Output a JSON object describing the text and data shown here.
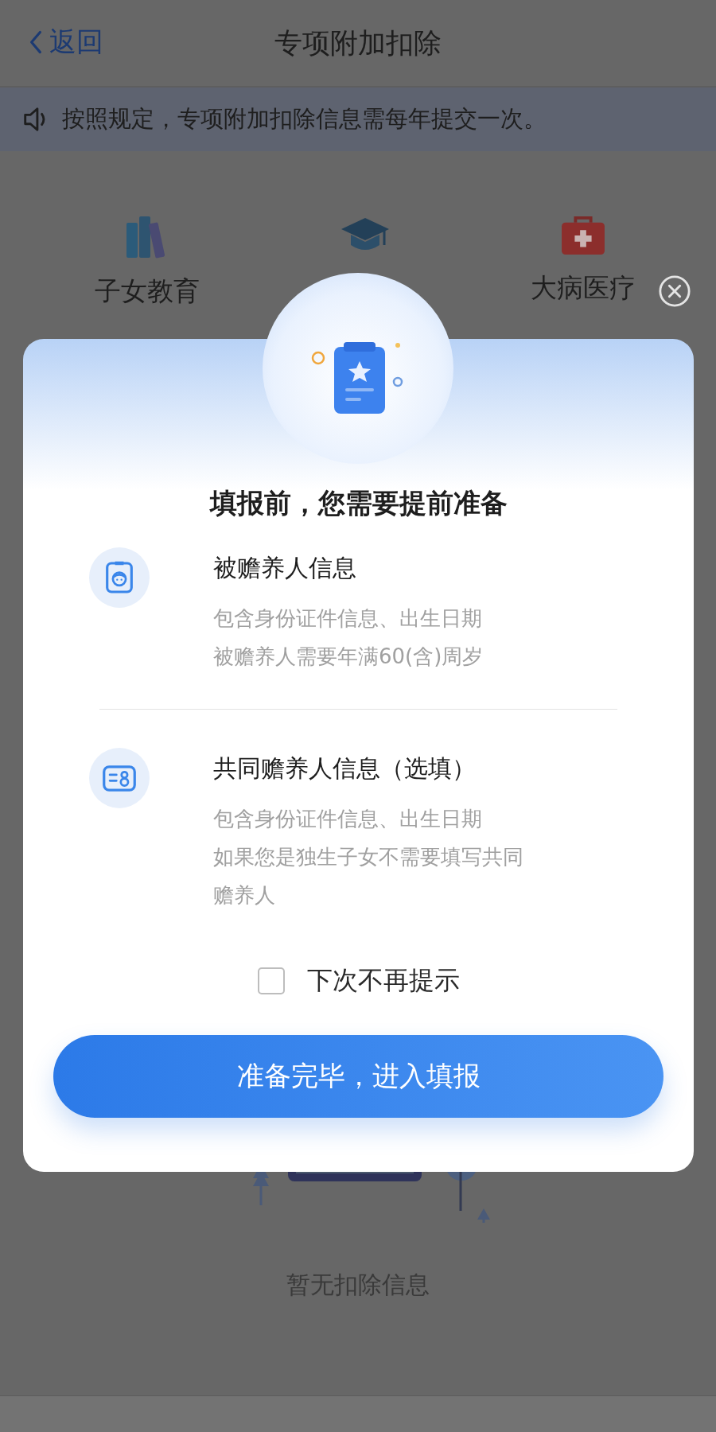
{
  "nav": {
    "back": "返回",
    "title": "专项附加扣除"
  },
  "notice": "按照规定，专项附加扣除信息需每年提交一次。",
  "categories": [
    {
      "kind": "books",
      "label": "子女教育"
    },
    {
      "kind": "cap"
    },
    {
      "kind": "medkit",
      "label": "大病医疗"
    }
  ],
  "empty_text": "暂无扣除信息",
  "dialog": {
    "title": "填报前，您需要提前准备",
    "items": [
      {
        "kind": "person",
        "title": "被赡养人信息",
        "lines": [
          "包含身份证件信息、出生日期",
          "被赡养人需要年满60(含)周岁"
        ]
      },
      {
        "kind": "card",
        "title": "共同赡养人信息（选填）",
        "lines": [
          "包含身份证件信息、出生日期",
          "如果您是独生子女不需要填写共同赡养人"
        ]
      }
    ],
    "dont_show_again": {
      "label": "下次不再提示",
      "checked": false
    },
    "button": "准备完毕，进入填报"
  }
}
